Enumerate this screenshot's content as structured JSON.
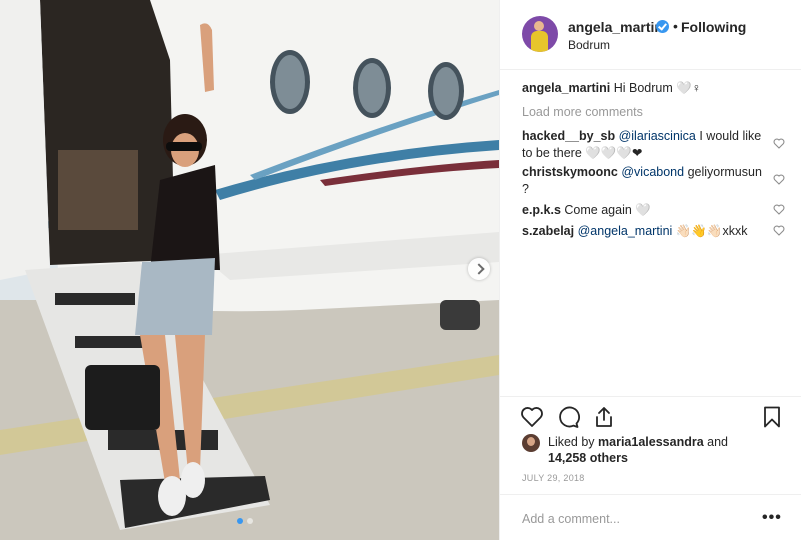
{
  "post": {
    "username": "angela_martini",
    "follow_separator": "•",
    "follow_label": "Following",
    "location": "Bodrum",
    "caption_user": "angela_martini",
    "caption_text": "Hi Bodrum 🤍♀",
    "load_more": "Load more comments",
    "date": "JULY 29, 2018",
    "add_comment_placeholder": "Add a comment...",
    "more_label": "•••"
  },
  "comments": [
    {
      "user": "hacked__by_sb",
      "mention": "@ilariascinica",
      "text": " I would like to be there 🤍🤍🤍❤"
    },
    {
      "user": "christskymoonc",
      "mention": "@vicabond",
      "text": " geliyormusun ?"
    },
    {
      "user": "e.p.k.s",
      "mention": "",
      "text": "Come again 🤍"
    },
    {
      "user": "s.zabelaj",
      "mention": "@angela_martini",
      "text": " 👋🏻👋👋🏻xkxk"
    }
  ],
  "likes": {
    "prefix": "Liked by ",
    "user": "maria1alessandra",
    "middle": " and",
    "count": "14,258 others"
  },
  "colors": {
    "accent": "#3897f0",
    "mention": "#003569",
    "muted": "#999999",
    "text": "#262626"
  },
  "icons": [
    "verified-badge-icon",
    "heart-icon",
    "comment-icon",
    "share-icon",
    "bookmark-icon",
    "chevron-right-icon",
    "more-icon"
  ]
}
